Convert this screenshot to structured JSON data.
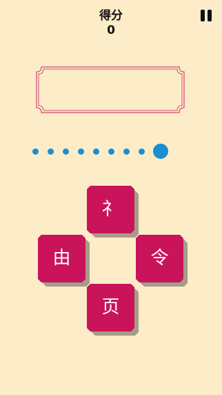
{
  "header": {
    "score_label": "得分",
    "score_value": "0"
  },
  "progress": {
    "total_steps": 9,
    "current_step": 9
  },
  "tiles": {
    "top": "礻",
    "left": "由",
    "right": "令",
    "bottom": "页"
  },
  "colors": {
    "background": "#fcecc8",
    "tile": "#c9145c",
    "tile_shadow": "#a59d88",
    "dot": "#1a8ed1",
    "box_border": "#d4476f"
  },
  "icons": {
    "pause": "pause-icon"
  }
}
